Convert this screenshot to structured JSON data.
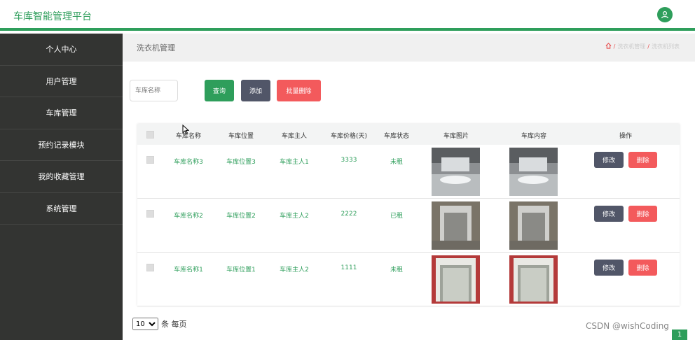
{
  "header": {
    "title": "车库智能管理平台"
  },
  "sidebar": {
    "items": [
      {
        "label": "个人中心"
      },
      {
        "label": "用户管理"
      },
      {
        "label": "车库管理"
      },
      {
        "label": "预约记录模块"
      },
      {
        "label": "我的收藏管理"
      },
      {
        "label": "系统管理"
      }
    ]
  },
  "main": {
    "title": "洗衣机管理",
    "breadcrumb": [
      "洗衣机管理",
      "洗衣机列表"
    ]
  },
  "search": {
    "placeholder": "车库名称",
    "query_label": "查询",
    "add_label": "添加",
    "batch_delete_label": "批量删除"
  },
  "table": {
    "columns": [
      "车库名称",
      "车库位置",
      "车库主人",
      "车库价格(天)",
      "车库状态",
      "车库图片",
      "车库内容",
      "操作"
    ],
    "rows": [
      {
        "name": "车库名称3",
        "location": "车库位置3",
        "owner": "车库主人1",
        "price": "3333",
        "status": "未租"
      },
      {
        "name": "车库名称2",
        "location": "车库位置2",
        "owner": "车库主人2",
        "price": "2222",
        "status": "已租"
      },
      {
        "name": "车库名称1",
        "location": "车库位置1",
        "owner": "车库主人2",
        "price": "1111",
        "status": "未租"
      }
    ],
    "edit_label": "修改",
    "delete_label": "删除"
  },
  "pager": {
    "page_size": "10",
    "suffix": "条 每页",
    "current_page": "1"
  },
  "watermark": "CSDN @wishCoding",
  "colors": {
    "accent": "#2e9e5b",
    "sidebar": "#333432",
    "danger": "#f35a5c",
    "neutral": "#515668"
  }
}
